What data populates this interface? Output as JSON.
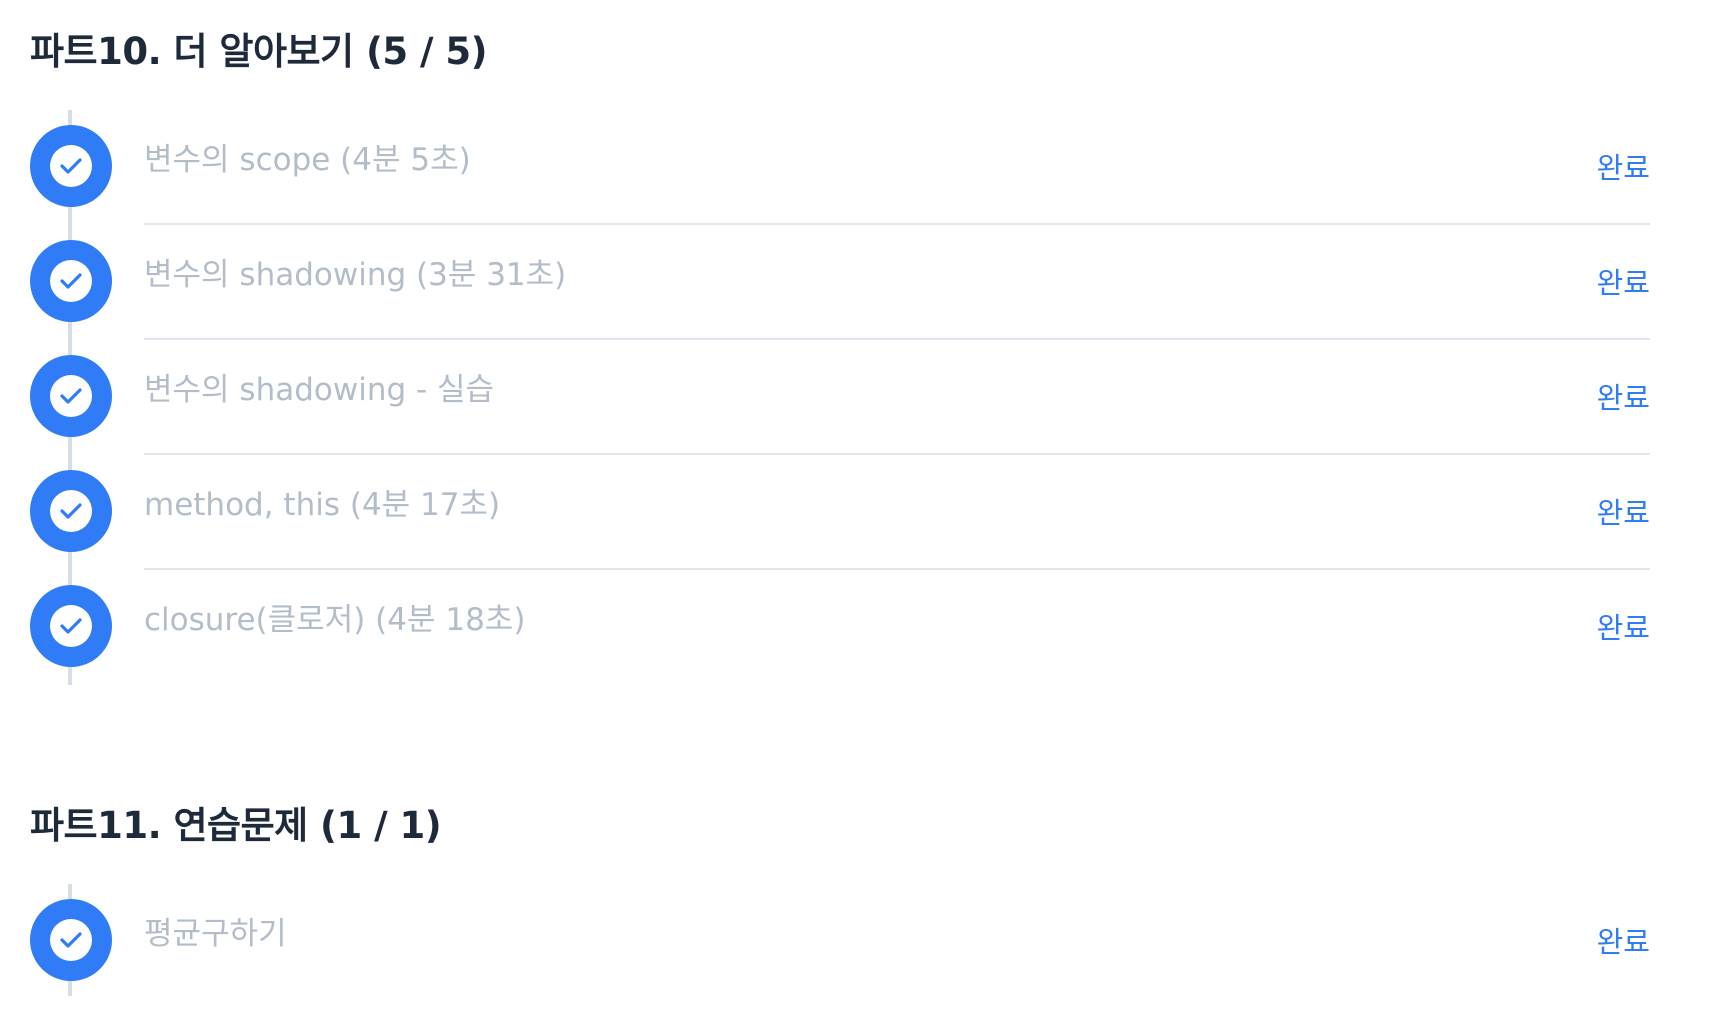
{
  "sections": [
    {
      "title": "파트10. 더 알아보기 (5 / 5)",
      "lessons": [
        {
          "title": "변수의 scope (4분 5초)",
          "status": "완료"
        },
        {
          "title": "변수의 shadowing (3분 31초)",
          "status": "완료"
        },
        {
          "title": "변수의 shadowing - 실습",
          "status": "완료"
        },
        {
          "title": "method, this (4분 17초)",
          "status": "완료"
        },
        {
          "title": "closure(클로저) (4분 18초)",
          "status": "완료"
        }
      ]
    },
    {
      "title": "파트11. 연습문제 (1 / 1)",
      "lessons": [
        {
          "title": "평균구하기",
          "status": "완료"
        }
      ]
    }
  ],
  "colors": {
    "accent": "#2f7cf6",
    "title_text": "#1e2a3a",
    "lesson_text": "#b2bdc9",
    "timeline": "#d7dde5",
    "divider": "#dfe6ee"
  },
  "icons": {
    "completed": "check-circle-icon"
  }
}
